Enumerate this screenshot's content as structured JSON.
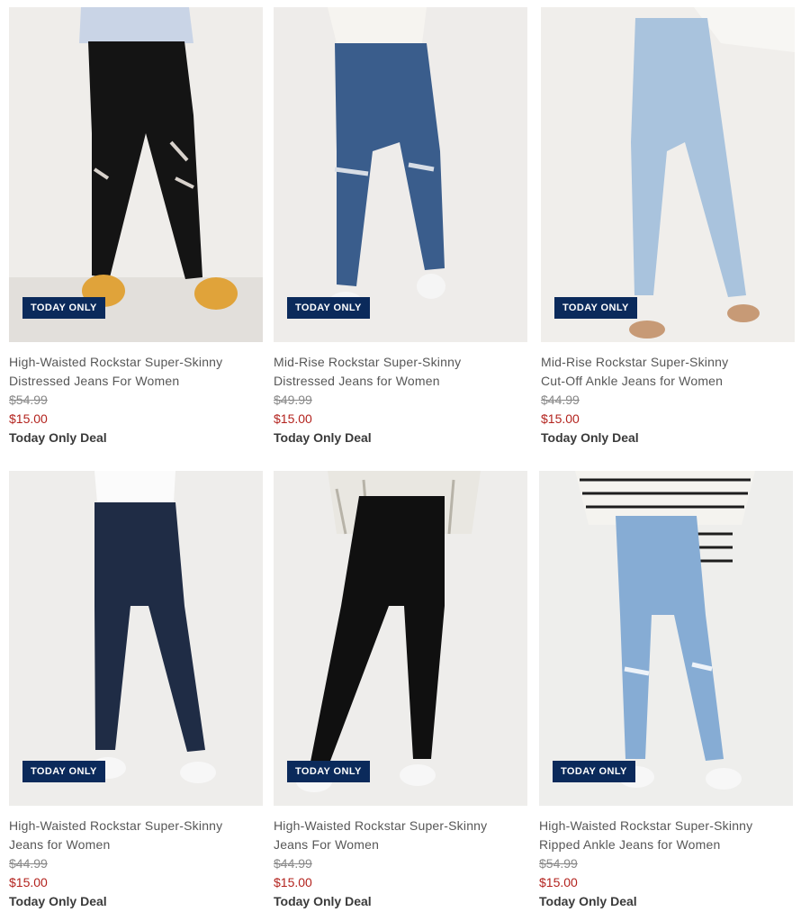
{
  "products": [
    {
      "badge": "TODAY ONLY",
      "name_line1": "High-Waisted Rockstar Super-Skinny",
      "name_line2": "Distressed Jeans For Women",
      "original_price": "$54.99",
      "sale_price": "$15.00",
      "deal": "Today Only Deal",
      "jeans_color": "#141414",
      "wash_name": "black-distressed"
    },
    {
      "badge": "TODAY ONLY",
      "name_line1": "Mid-Rise Rockstar Super-Skinny",
      "name_line2": "Distressed Jeans for Women",
      "original_price": "$49.99",
      "sale_price": "$15.00",
      "deal": "Today Only Deal",
      "jeans_color": "#3a5d8c",
      "wash_name": "medium-blue-distressed"
    },
    {
      "badge": "TODAY ONLY",
      "name_line1": "Mid-Rise Rockstar Super-Skinny",
      "name_line2": "Cut-Off Ankle Jeans for Women",
      "original_price": "$44.99",
      "sale_price": "$15.00",
      "deal": "Today Only Deal",
      "jeans_color": "#a9c3dd",
      "wash_name": "light-blue"
    },
    {
      "badge": "TODAY ONLY",
      "name_line1": "High-Waisted Rockstar Super-Skinny",
      "name_line2": "Jeans for Women",
      "original_price": "$44.99",
      "sale_price": "$15.00",
      "deal": "Today Only Deal",
      "jeans_color": "#1f2c45",
      "wash_name": "dark-indigo"
    },
    {
      "badge": "TODAY ONLY",
      "name_line1": "High-Waisted Rockstar Super-Skinny",
      "name_line2": "Jeans For Women",
      "original_price": "$44.99",
      "sale_price": "$15.00",
      "deal": "Today Only Deal",
      "jeans_color": "#101010",
      "wash_name": "black"
    },
    {
      "badge": "TODAY ONLY",
      "name_line1": "High-Waisted Rockstar Super-Skinny",
      "name_line2": "Ripped Ankle Jeans for Women",
      "original_price": "$54.99",
      "sale_price": "$15.00",
      "deal": "Today Only Deal",
      "jeans_color": "#86acd4",
      "wash_name": "light-blue-ripped"
    }
  ],
  "colors": {
    "badge_bg": "#0b2a5b",
    "sale_price": "#b3231e",
    "photo_bg": "#eceae8"
  }
}
